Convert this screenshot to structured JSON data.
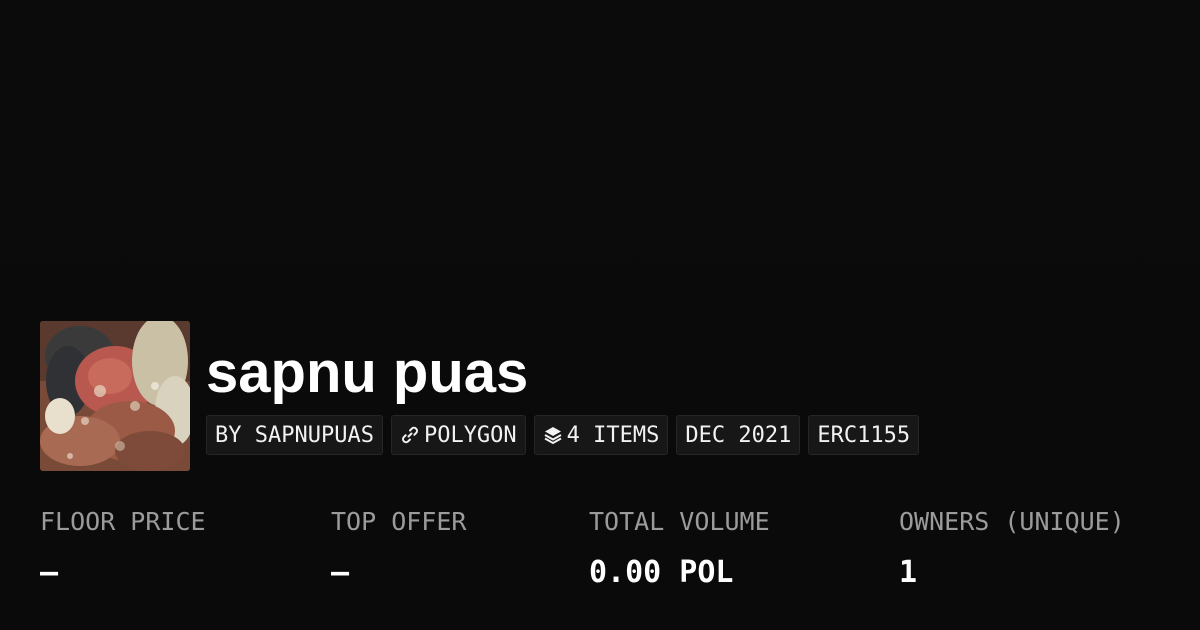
{
  "collection": {
    "name": "sapnu puas",
    "chips": [
      {
        "label": "BY SAPNUPUAS",
        "icon": null
      },
      {
        "label": "POLYGON",
        "icon": "chain-link-icon"
      },
      {
        "label": "4 ITEMS",
        "icon": "layers-icon"
      },
      {
        "label": "DEC 2021",
        "icon": null
      },
      {
        "label": "ERC1155",
        "icon": null
      }
    ]
  },
  "stats": [
    {
      "label": "FLOOR PRICE",
      "value": "–"
    },
    {
      "label": "TOP OFFER",
      "value": "–"
    },
    {
      "label": "TOTAL VOLUME",
      "value": "0.00 POL"
    },
    {
      "label": "OWNERS (UNIQUE)",
      "value": "1"
    }
  ],
  "colors": {
    "background": "#0b0b0b",
    "chip_background": "#171717",
    "label_gray": "#9b9b9b",
    "text": "#ffffff"
  }
}
